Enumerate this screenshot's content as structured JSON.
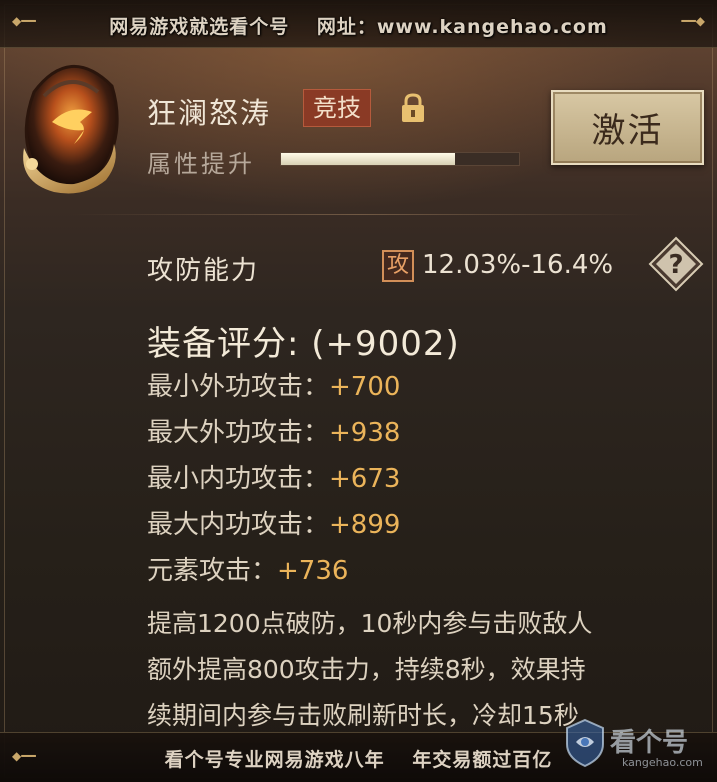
{
  "watermark_top": {
    "left": "网易游戏就选看个号",
    "right": "网址：www.kangehao.com"
  },
  "equipment": {
    "name": "狂澜怒涛",
    "tag": "竞技",
    "attr_label": "属性提升",
    "attr_progress": 0.73,
    "activate_label": "激活"
  },
  "ability": {
    "label": "攻防能力",
    "badge": "攻",
    "range": "12.03%-16.4%"
  },
  "score": "装备评分: (+9002)",
  "stats": [
    {
      "name": "最小外功攻击：",
      "value": "+700"
    },
    {
      "name": "最大外功攻击：",
      "value": "+938"
    },
    {
      "name": "最小内功攻击：",
      "value": "+673"
    },
    {
      "name": "最大内功攻击：",
      "value": "+899"
    },
    {
      "name": "元素攻击：",
      "value": "+736"
    }
  ],
  "description": [
    "提高1200点破防，10秒内参与击败敌人",
    "额外提高800攻击力，持续8秒，效果持",
    "续期间内参与击败刷新时长，冷却15秒"
  ],
  "watermark_bottom": {
    "left": "看个号专业网易游戏八年",
    "right": "年交易额过百亿"
  },
  "brand": {
    "name": "看个号",
    "domain": "kangehao.com"
  },
  "colors": {
    "value_gold": "#ebb45a",
    "tag_red": "#8a3a25",
    "button_gold": "#d8c8a4"
  }
}
